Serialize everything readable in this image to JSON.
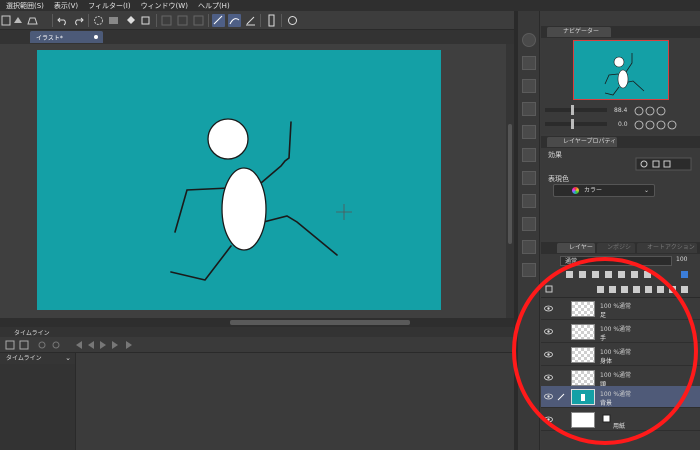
{
  "menu": {
    "items": [
      "選択範囲(S)",
      "表示(V)",
      "フィルター(I)",
      "ウィンドウ(W)",
      "ヘルプ(H)"
    ]
  },
  "canvas": {
    "tab_label": "イラスト*",
    "background_color": "#14a0a6"
  },
  "timeline": {
    "panel_title": "タイムライン",
    "track_label": "タイムライン"
  },
  "navigator": {
    "tab_label": "ナビゲーター",
    "zoom": "88.4",
    "rotation": "0.0"
  },
  "layer_property": {
    "tab_label": "レイヤープロパティ",
    "effect_label": "効果",
    "expression_color_label": "表現色",
    "color_value": "カラー"
  },
  "layer_panel": {
    "tab_label": "レイヤー",
    "other_tabs": [
      "ンポジション",
      "オートアクション"
    ],
    "blend_mode": "通常",
    "opacity": "100",
    "layers": [
      {
        "mode": "100 %通常",
        "name": "足",
        "selected": false,
        "type": "raster"
      },
      {
        "mode": "100 %通常",
        "name": "手",
        "selected": false,
        "type": "raster"
      },
      {
        "mode": "100 %通常",
        "name": "身体",
        "selected": false,
        "type": "raster"
      },
      {
        "mode": "100 %通常",
        "name": "頭",
        "selected": false,
        "type": "raster"
      },
      {
        "mode": "100 %通常",
        "name": "背景",
        "selected": true,
        "type": "fill"
      },
      {
        "mode": "",
        "name": "用紙",
        "selected": false,
        "type": "paper"
      }
    ]
  },
  "colors": {
    "accent_selection": "#4f5a78",
    "annotation": "#ff1a1a"
  }
}
